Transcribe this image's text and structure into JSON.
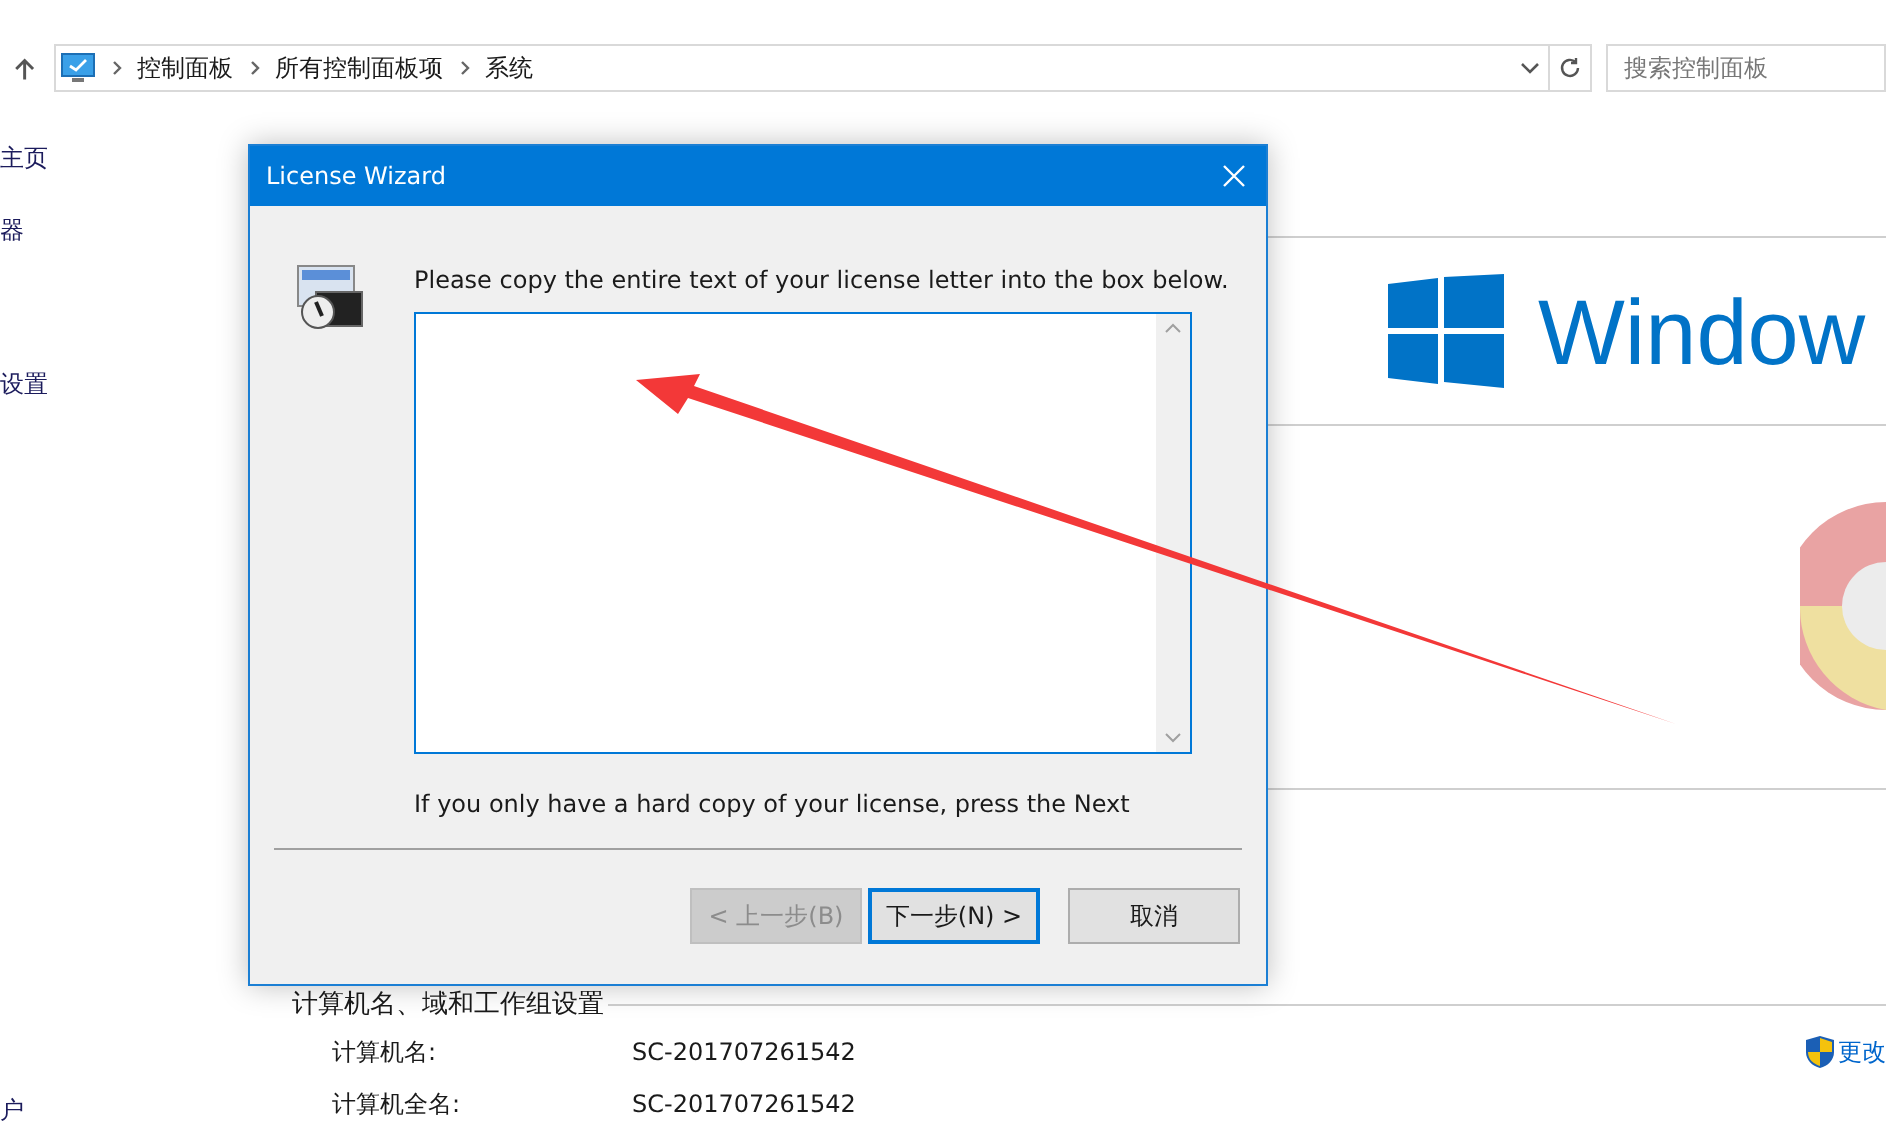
{
  "address_bar": {
    "crumbs": [
      "控制面板",
      "所有控制面板项",
      "系统"
    ],
    "search": {
      "placeholder": "搜索控制面板"
    }
  },
  "sidebar": {
    "items": [
      "主页",
      "器",
      "设置",
      "户"
    ]
  },
  "main": {
    "logo_text": "Window",
    "section_title": "计算机名、域和工作组设置",
    "rows": [
      {
        "label": "计算机名:",
        "value": "SC-201707261542"
      },
      {
        "label": "计算机全名:",
        "value": "SC-201707261542"
      }
    ],
    "change_link": "更改"
  },
  "dialog": {
    "title": "License Wizard",
    "instruction": "Please copy the entire text of your license letter into the box below.",
    "note": "If you only have a hard copy of your license, press the Next",
    "buttons": [
      {
        "label": "< 上一步(B)",
        "disabled": true,
        "focused": false
      },
      {
        "label": "下一步(N) >",
        "disabled": false,
        "focused": true
      },
      {
        "label": "取消",
        "disabled": false,
        "focused": false
      }
    ]
  }
}
